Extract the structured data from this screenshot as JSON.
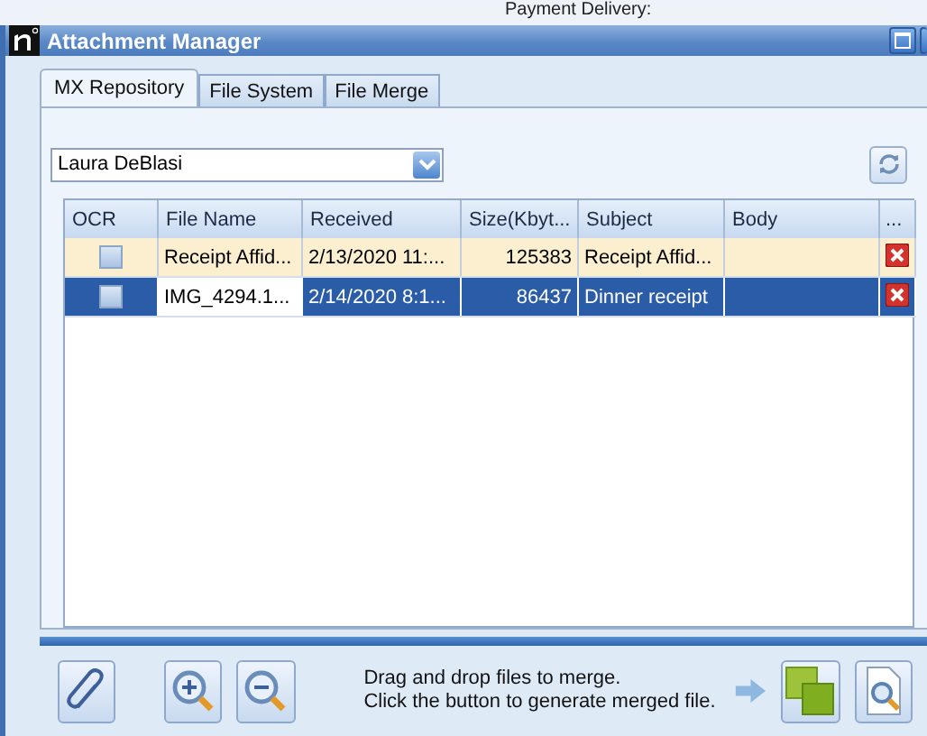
{
  "background_text": "Payment Delivery:",
  "window": {
    "title": "Attachment Manager"
  },
  "tabs": [
    {
      "label": "MX Repository",
      "selected": true
    },
    {
      "label": "File System",
      "selected": false
    },
    {
      "label": "File Merge",
      "selected": false
    }
  ],
  "contact_dropdown": {
    "value": "Laura DeBlasi"
  },
  "table": {
    "columns": [
      "OCR",
      "File Name",
      "Received",
      "Size(Kbyt...",
      "Subject",
      "Body",
      "..."
    ],
    "rows": [
      {
        "ocr_checked": false,
        "file_name": "Receipt Affid...",
        "received": "2/13/2020 11:...",
        "size": "125383",
        "subject": "Receipt Affid...",
        "body": "",
        "selected": false
      },
      {
        "ocr_checked": false,
        "file_name": "IMG_4294.1...",
        "received": "2/14/2020 8:1...",
        "size": "86437",
        "subject": "Dinner receipt",
        "body": "",
        "selected": true
      }
    ]
  },
  "merge_hint": [
    "Drag and drop files to merge.",
    "Click the button to generate merged file."
  ]
}
